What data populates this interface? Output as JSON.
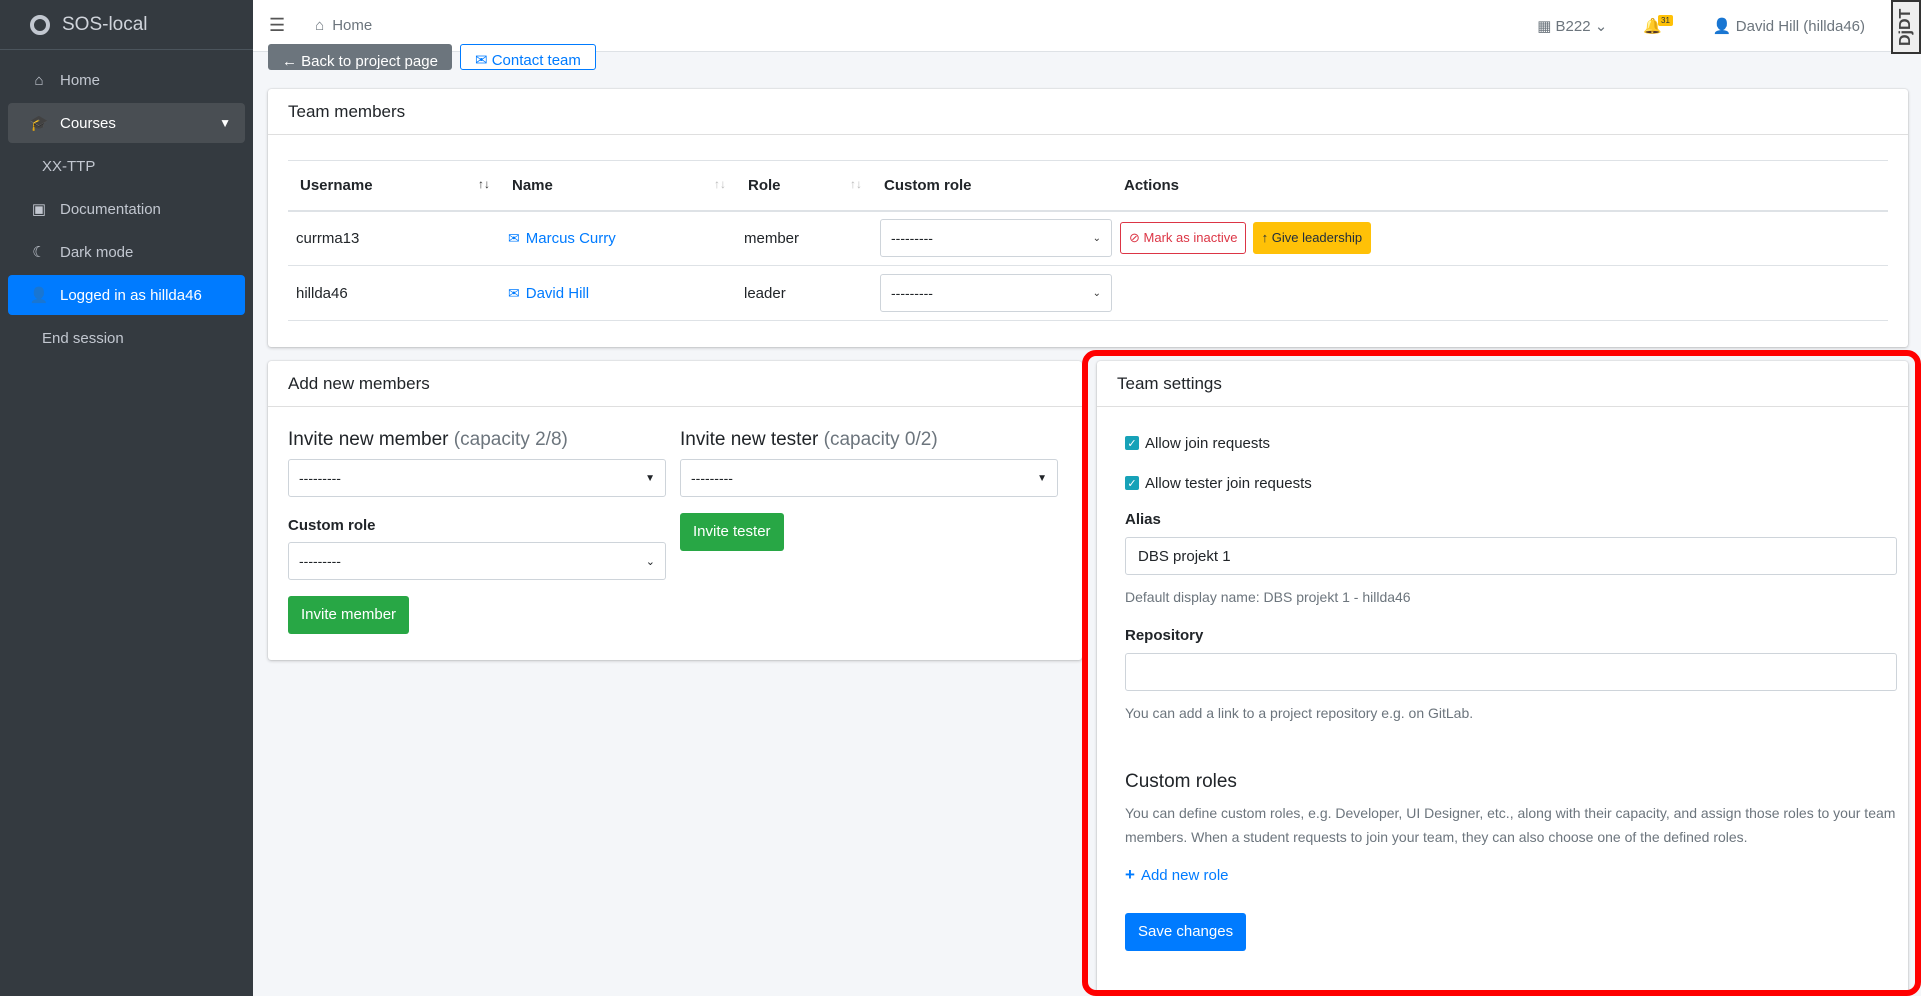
{
  "brand": {
    "name": "SOS-local"
  },
  "sidebar": {
    "items": [
      {
        "label": "Home",
        "icon": "home-icon"
      },
      {
        "label": "Courses",
        "icon": "graduation-cap-icon"
      },
      {
        "label": "XX-TTP"
      },
      {
        "label": "Documentation",
        "icon": "book-icon"
      },
      {
        "label": "Dark mode",
        "icon": "moon-icon"
      },
      {
        "label": "Logged in as hillda46",
        "icon": "user-cog-icon"
      },
      {
        "label": "End session"
      }
    ]
  },
  "topbar": {
    "breadcrumb": "Home",
    "semester": "B222",
    "notification_count": "31",
    "user": "David Hill (hillda46)",
    "djdt": "DjDT"
  },
  "actions": {
    "back": "Back to project page",
    "contact": "Contact team"
  },
  "members": {
    "title": "Team members",
    "columns": [
      "Username",
      "Name",
      "Role",
      "Custom role",
      "Actions"
    ],
    "rows": [
      {
        "username": "currma13",
        "name": "Marcus Curry",
        "role": "member",
        "custom_role": "---------"
      },
      {
        "username": "hillda46",
        "name": "David Hill",
        "role": "leader",
        "custom_role": "---------"
      }
    ],
    "mark_inactive": "Mark as inactive",
    "give_leadership": "Give leadership"
  },
  "add_members": {
    "title": "Add new members",
    "invite_member": "Invite new member",
    "member_capacity": "(capacity 2/8)",
    "member_select": "---------",
    "custom_role_label": "Custom role",
    "custom_role_select": "---------",
    "invite_member_button": "Invite member",
    "invite_tester": "Invite new tester",
    "tester_capacity": "(capacity 0/2)",
    "tester_select": "---------",
    "invite_tester_button": "Invite tester"
  },
  "settings": {
    "title": "Team settings",
    "allow_join": "Allow join requests",
    "allow_tester_join": "Allow tester join requests",
    "alias_label": "Alias",
    "alias_value": "DBS projekt 1",
    "alias_help": "Default display name: DBS projekt 1 - hillda46",
    "repo_label": "Repository",
    "repo_value": "",
    "repo_help": "You can add a link to a project repository e.g. on GitLab.",
    "custom_roles_title": "Custom roles",
    "custom_roles_text": "You can define custom roles, e.g. Developer, UI Designer, etc., along with their capacity, and assign those roles to your team members. When a student requests to join your team, they can also choose one of the defined roles.",
    "add_role": "Add new role",
    "save": "Save changes"
  }
}
